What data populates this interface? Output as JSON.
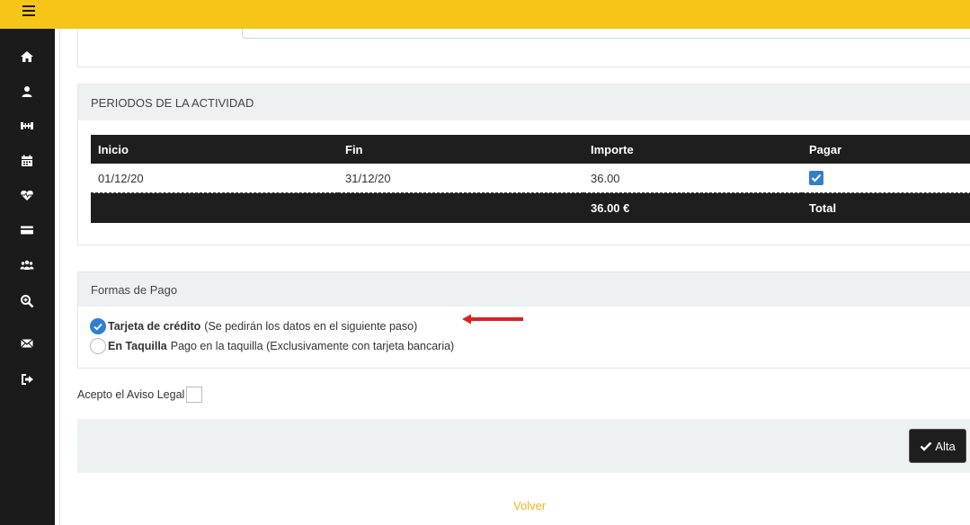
{
  "periods": {
    "title": "PERIODOS DE LA ACTIVIDAD",
    "columns": [
      "Inicio",
      "Fin",
      "Importe",
      "Pagar"
    ],
    "rows": [
      {
        "inicio": "01/12/20",
        "fin": "31/12/20",
        "importe": "36.00",
        "pagar": true
      }
    ],
    "total_amount": "36.00 €",
    "total_label": "Total"
  },
  "payment": {
    "title": "Formas de Pago",
    "options": [
      {
        "label": "Tarjeta de crédito",
        "desc": "(Se pedirán los datos en el siguiente paso)",
        "selected": true
      },
      {
        "label": "En Taquilla",
        "desc": "Pago en la taquilla (Exclusivamente con tarjeta bancaria)",
        "selected": false
      }
    ]
  },
  "legal": {
    "label": "Acepto el Aviso Legal",
    "checked": false
  },
  "actions": {
    "submit_label": "Alta",
    "back_label": "Volver"
  },
  "colors": {
    "accent": "#f5c518",
    "sidebar": "#1b1b1b",
    "check": "#2f7fd0",
    "arrow": "#e02020",
    "link": "#f0b323"
  },
  "sidebar_icons": [
    "home-icon",
    "user-icon",
    "dumbbell-icon",
    "calendar-icon",
    "heart-icon",
    "card-icon",
    "group-icon",
    "search-icon",
    "mail-icon",
    "logout-icon"
  ]
}
